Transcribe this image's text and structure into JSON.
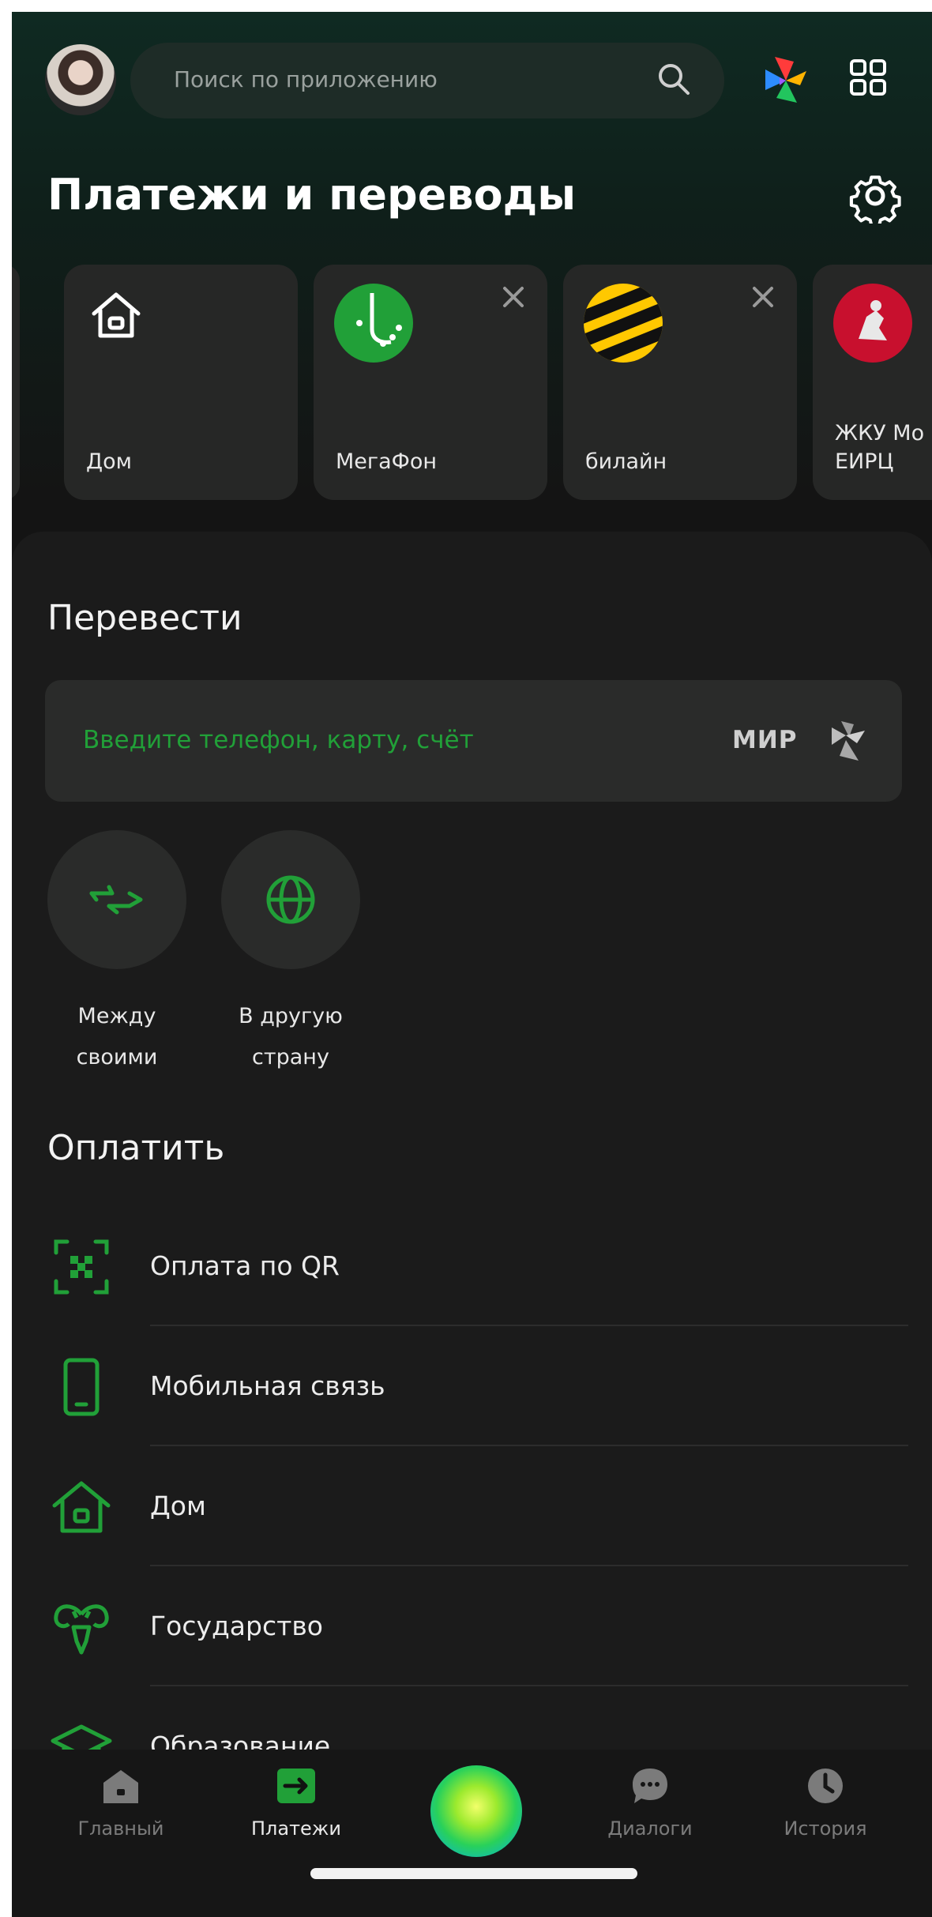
{
  "search": {
    "placeholder": "Поиск по приложению"
  },
  "header": {
    "title": "Платежи и переводы"
  },
  "favorites": [
    {
      "label": "Дом"
    },
    {
      "label": "МегаФон"
    },
    {
      "label": "билайн"
    },
    {
      "label": "ЖКУ Мо\nЕИРЦ"
    }
  ],
  "transfer": {
    "title": "Перевести",
    "input_placeholder": "Введите телефон, карту, счёт",
    "payment_system": "МИР",
    "actions": [
      {
        "label": "Между\nсвоими",
        "icon": "transfer-arrows-icon"
      },
      {
        "label": "В другую\nстрану",
        "icon": "globe-icon"
      }
    ]
  },
  "pay": {
    "title": "Оплатить",
    "items": [
      {
        "label": "Оплата по QR",
        "icon": "qr-scan-icon"
      },
      {
        "label": "Мобильная связь",
        "icon": "phone-icon"
      },
      {
        "label": "Дом",
        "icon": "house-icon"
      },
      {
        "label": "Государство",
        "icon": "emblem-icon"
      },
      {
        "label": "Образование",
        "icon": "graduation-cap-icon"
      }
    ]
  },
  "nav": {
    "items": [
      {
        "label": "Главный",
        "active": false
      },
      {
        "label": "Платежи",
        "active": true
      },
      {
        "label": "Диалоги",
        "active": false
      },
      {
        "label": "История",
        "active": false
      }
    ]
  },
  "colors": {
    "accent": "#21a038",
    "background": "#161616"
  }
}
